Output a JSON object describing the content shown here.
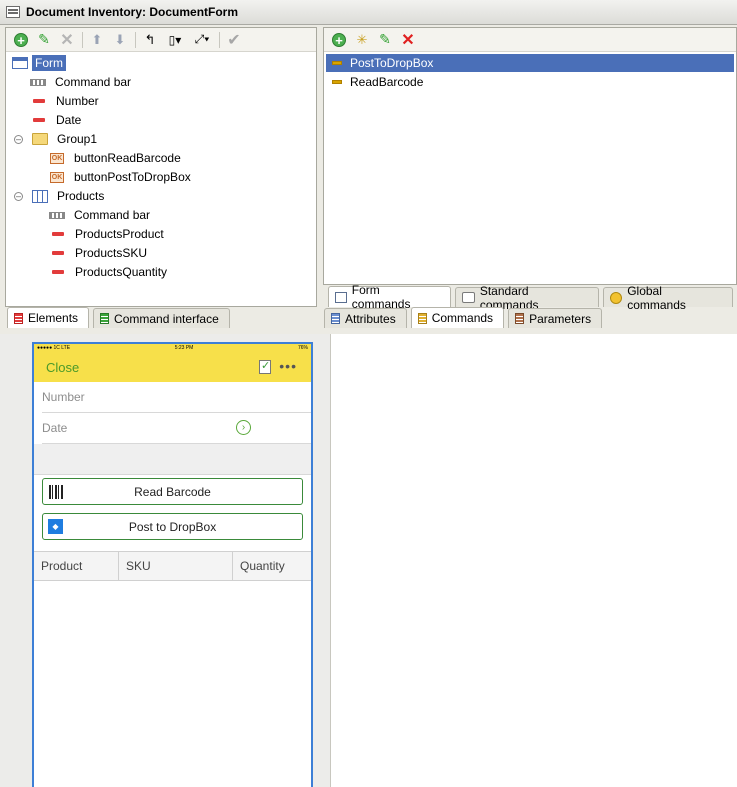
{
  "window": {
    "title": "Document Inventory: DocumentForm"
  },
  "left_toolbar": {
    "buttons": [
      "add-icon",
      "edit-icon",
      "delete-icon",
      "move-up-icon",
      "move-down-icon",
      "change-parent-icon",
      "layout-icon",
      "expand-icon",
      "check-icon"
    ]
  },
  "elements_tree": {
    "items": [
      {
        "label": "Form",
        "icon": "form-icon",
        "selected": true
      },
      {
        "label": "Command bar",
        "icon": "command-bar-icon"
      },
      {
        "label": "Number",
        "icon": "field-icon"
      },
      {
        "label": "Date",
        "icon": "field-icon"
      },
      {
        "label": "Group1",
        "icon": "folder-icon"
      },
      {
        "label": "buttonReadBarcode",
        "icon": "button-icon"
      },
      {
        "label": "buttonPostToDropBox",
        "icon": "button-icon"
      },
      {
        "label": "Products",
        "icon": "table-icon"
      },
      {
        "label": "Command bar",
        "icon": "command-bar-icon"
      },
      {
        "label": "ProductsProduct",
        "icon": "field-icon"
      },
      {
        "label": "ProductsSKU",
        "icon": "field-icon"
      },
      {
        "label": "ProductsQuantity",
        "icon": "field-icon"
      }
    ]
  },
  "left_tabs": {
    "elements": "Elements",
    "command_interface": "Command interface"
  },
  "commands_list": {
    "items": [
      {
        "label": "PostToDropBox",
        "selected": true
      },
      {
        "label": "ReadBarcode"
      }
    ]
  },
  "command_subtabs": {
    "form": "Form commands",
    "standard": "Standard commands",
    "global": "Global commands"
  },
  "right_tabs": {
    "attributes": "Attributes",
    "commands": "Commands",
    "parameters": "Parameters"
  },
  "preview": {
    "status_left": "●●●●● 1C LTE",
    "status_time": "5:23 PM",
    "status_right": "76%",
    "close_label": "Close",
    "more_label": "•••",
    "number_placeholder": "Number",
    "date_placeholder": "Date",
    "read_barcode_label": "Read Barcode",
    "post_dropbox_label": "Post to DropBox",
    "columns": [
      "Product",
      "SKU",
      "Quantity"
    ]
  },
  "colors": {
    "selection": "#4a6fb8",
    "mobile_header": "#f7e04a",
    "accent_green": "#3a8a3a",
    "phone_frame": "#3d7fd6"
  }
}
